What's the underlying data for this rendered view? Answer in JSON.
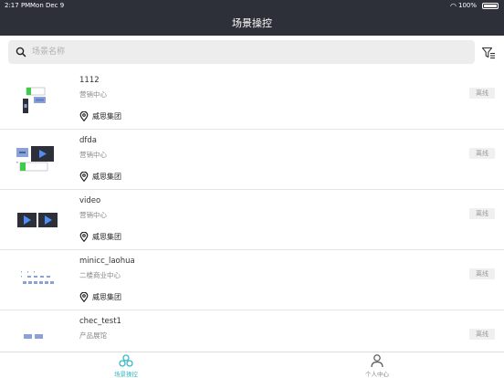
{
  "status": {
    "time": "2:17 PM",
    "date": "Mon Dec 9",
    "battery": "100%"
  },
  "nav": {
    "title": "场景操控"
  },
  "search": {
    "placeholder": "场景名称",
    "value": ""
  },
  "scenes": [
    {
      "name": "1112",
      "group": "营销中心",
      "org": "威思集团",
      "status": "离线"
    },
    {
      "name": "dfda",
      "group": "营销中心",
      "org": "威思集团",
      "status": "离线"
    },
    {
      "name": "video",
      "group": "营销中心",
      "org": "威思集团",
      "status": "离线"
    },
    {
      "name": "minicc_laohua",
      "group": "二楼商业中心",
      "org": "威思集团",
      "status": "离线"
    },
    {
      "name": "chec_test1",
      "group": "产品展馆",
      "org": "",
      "status": "离线"
    }
  ],
  "tabs": [
    {
      "label": "场景操控",
      "icon": "scene-control-icon",
      "active": true
    },
    {
      "label": "个人中心",
      "icon": "person-icon",
      "active": false
    }
  ],
  "colors": {
    "header": "#2d3038",
    "accent": "#3ab7c6",
    "thumb_blue": "#8aa2d8",
    "thumb_green": "#3fcc4a"
  }
}
